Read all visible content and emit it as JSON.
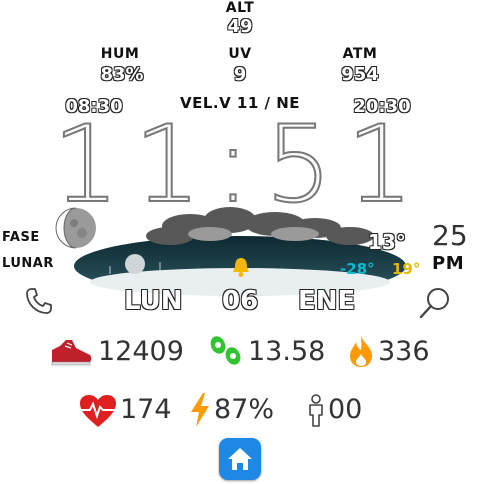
{
  "top": {
    "alt_label": "ALT",
    "alt_value": "49",
    "hum_label": "HUM",
    "hum_value": "83%",
    "uv_label": "UV",
    "uv_value": "9",
    "atm_label": "ATM",
    "atm_value": "954",
    "sunrise": "08:30",
    "sunset": "20:30",
    "wind": "VEL.V 11 / NE"
  },
  "clock": {
    "time": "11:51",
    "seconds": "25",
    "ampm": "PM"
  },
  "moon": {
    "label_line1": "FASE",
    "label_line2": "LUNAR"
  },
  "weather": {
    "current_temp": "13°",
    "min_temp": "-28°",
    "max_temp": "19°"
  },
  "date": {
    "day": "LUN",
    "date": "06",
    "month": "ENE"
  },
  "stats": {
    "steps": "12409",
    "distance": "13.58",
    "calories": "336"
  },
  "health": {
    "heart_rate": "174",
    "battery": "87%",
    "floors": "00"
  },
  "colors": {
    "sneaker": "#c0202a",
    "distance": "#2ec52e",
    "flame": "#ff9b00",
    "heart": "#e02020",
    "bolt": "#ff9b00",
    "home_btn": "#1e88e5",
    "min_temp": "#00bcd4",
    "max_temp": "#e2b800"
  },
  "icons": {
    "phone": "phone-icon",
    "search": "search-icon",
    "sneaker": "sneaker-icon",
    "distance": "footprint-icon",
    "flame": "flame-icon",
    "heart": "heart-rate-icon",
    "bolt": "battery-bolt-icon",
    "person": "person-icon",
    "bell": "bell-icon",
    "moon": "moon-icon",
    "home": "home-icon"
  }
}
